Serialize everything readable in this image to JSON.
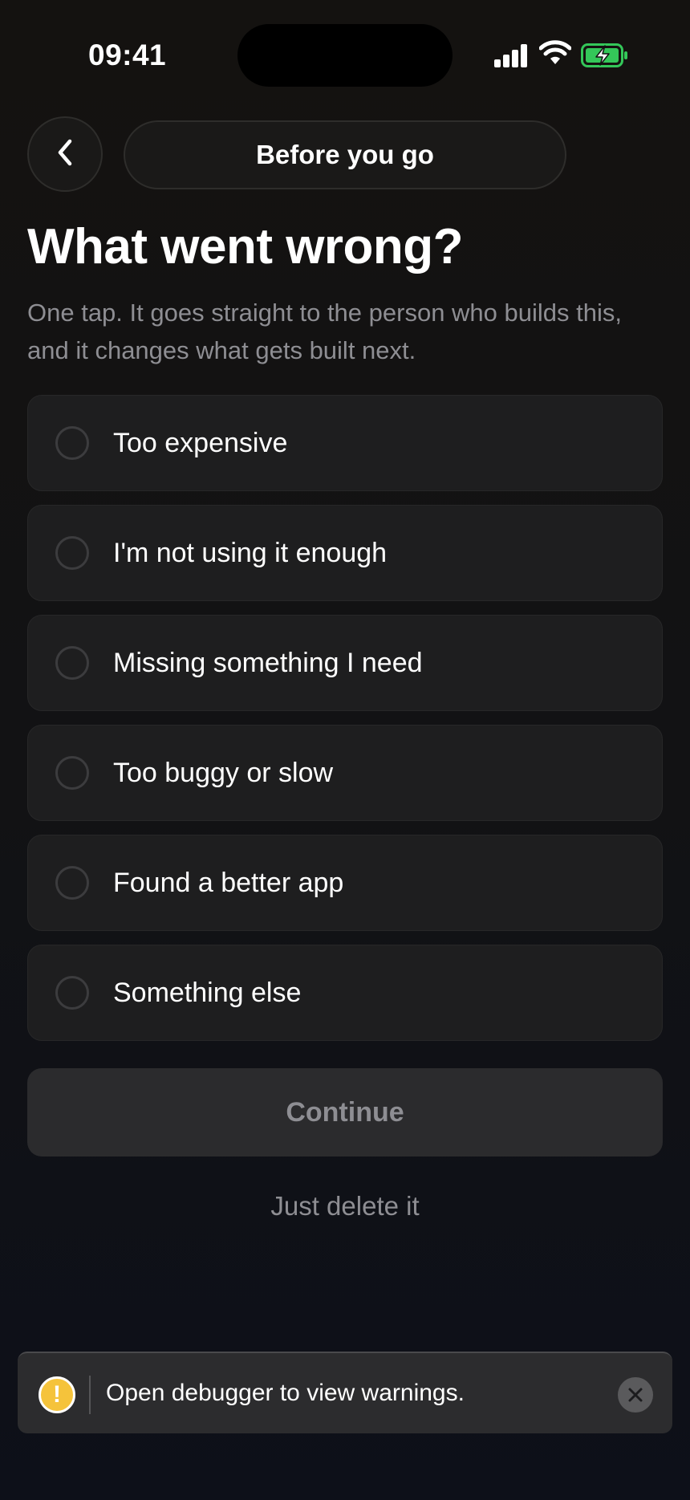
{
  "status_bar": {
    "time": "09:41",
    "signal_icon": "cellular-signal-icon",
    "wifi_icon": "wifi-icon",
    "battery_icon": "battery-charging-icon",
    "battery_color": "#34c759"
  },
  "header": {
    "back_icon": "chevron-left-icon",
    "title": "Before you go"
  },
  "main": {
    "heading": "What went wrong?",
    "subtext": "One tap. It goes straight to the person who builds this, and it changes what gets built next.",
    "options": [
      {
        "label": "Too expensive",
        "selected": false
      },
      {
        "label": "I'm not using it enough",
        "selected": false
      },
      {
        "label": "Missing something I need",
        "selected": false
      },
      {
        "label": "Too buggy or slow",
        "selected": false
      },
      {
        "label": "Found a better app",
        "selected": false
      },
      {
        "label": "Something else",
        "selected": false
      }
    ],
    "continue_label": "Continue",
    "delete_label": "Just delete it"
  },
  "toast": {
    "icon": "warning-icon",
    "message": "Open debugger to view warnings.",
    "close_icon": "close-icon",
    "accent": "#f5c33b"
  }
}
